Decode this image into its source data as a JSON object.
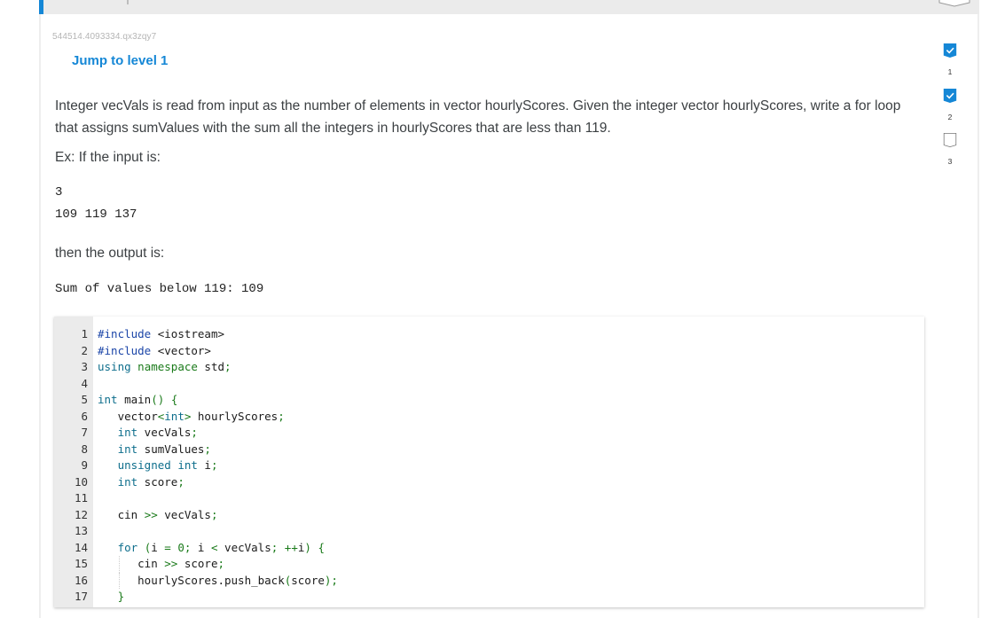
{
  "activity_id": "544514.4093334.qx3zqy7",
  "jump_link": "Jump to level 1",
  "prompt": "Integer vecVals is read from input as the number of elements in vector hourlyScores. Given the integer vector hourlyScores, write a for loop that assigns sumValues with the sum all the integers in hourlyScores that are less than 119.",
  "example": {
    "input_label": "Ex: If the input is:",
    "input_lines": [
      "3",
      "109 119 137"
    ],
    "output_label": "then the output is:",
    "output_line": "Sum of values below 119: 109"
  },
  "levels": [
    {
      "number": "1",
      "completed": true
    },
    {
      "number": "2",
      "completed": true
    },
    {
      "number": "3",
      "completed": false
    }
  ],
  "colors": {
    "accent": "#1587d6",
    "text": "#3c4043",
    "gutter": "#ebebeb"
  },
  "code": {
    "line_numbers": [
      "1",
      "2",
      "3",
      "4",
      "5",
      "6",
      "7",
      "8",
      "9",
      "10",
      "11",
      "12",
      "13",
      "14",
      "15",
      "16",
      "17"
    ],
    "lines": [
      "#include <iostream>",
      "#include <vector>",
      "using namespace std;",
      "",
      "int main() {",
      "   vector<int> hourlyScores;",
      "   int vecVals;",
      "   int sumValues;",
      "   unsigned int i;",
      "   int score;",
      "",
      "   cin >> vecVals;",
      "",
      "   for (i = 0; i < vecVals; ++i) {",
      "      cin >> score;",
      "      hourlyScores.push_back(score);",
      "   }"
    ]
  }
}
